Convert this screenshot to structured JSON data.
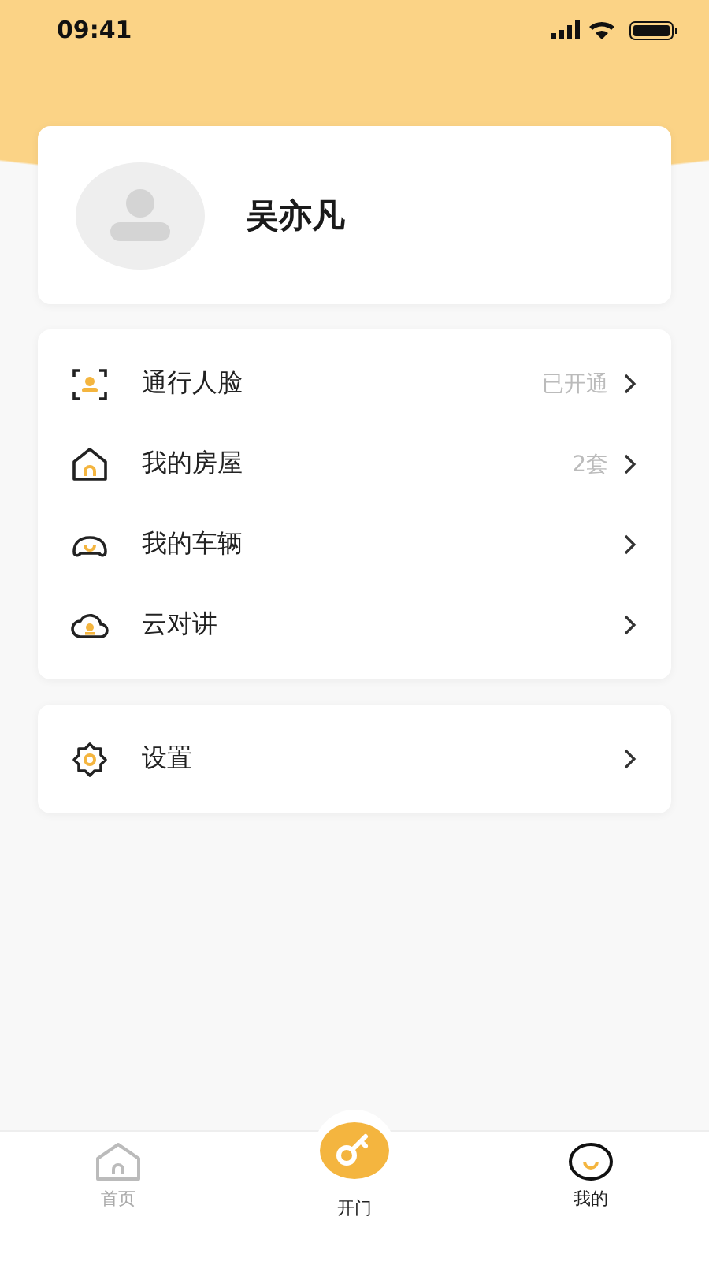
{
  "status_bar": {
    "time": "09:41"
  },
  "profile": {
    "name": "吴亦凡"
  },
  "menu_groups": [
    {
      "items": [
        {
          "kind": "face",
          "label": "通行人脸",
          "value": "已开通"
        },
        {
          "kind": "house",
          "label": "我的房屋",
          "value": "2套"
        },
        {
          "kind": "car",
          "label": "我的车辆"
        },
        {
          "kind": "cloud",
          "label": "云对讲"
        }
      ]
    },
    {
      "items": [
        {
          "kind": "gear",
          "label": "设置"
        }
      ]
    }
  ],
  "tab_bar": [
    {
      "kind": "home",
      "label": "首页",
      "selected": false
    },
    {
      "kind": "key",
      "label": "开门",
      "selected": false
    },
    {
      "kind": "me",
      "label": "我的",
      "selected": true
    }
  ]
}
